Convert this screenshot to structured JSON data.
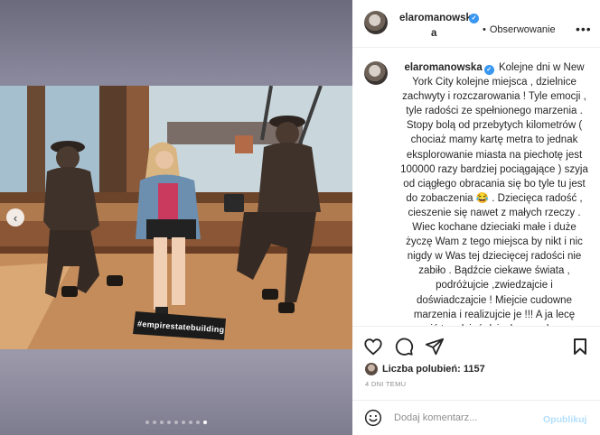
{
  "post": {
    "username_line1": "elaromanowsk",
    "username_line2": "a",
    "follow_separator": "•",
    "follow_label": "Obserwowanie",
    "caption_author": "elaromanowska",
    "caption_text": "Kolejne dni w New York City kolejne miejsca , dzielnice zachwyty i rozczarowania ! Tyle emocji , tyle radości ze spełnionego marzenia . Stopy bolą od przebytych kilometrów ( chociaż mamy kartę metra to jednak eksplorowanie miasta na piechotę jest 100000 razy bardziej pociągające ) szyja od ciągłego obracania się bo tyle tu jest do zobaczenia 😂 . Dziecięca radość , cieszenie się nawet z małych rzeczy . Wiec kochane dzieciaki małe i duże życzę Wam z tego miejsca by nikt i nic nigdy w Was tej dziecięcej radości nie zabiło . Bądźcie ciekawe świata , podróżujcie ,zwiedzajcie i doświadczajcie ! Miejcie cudowne marzenia i realizujcie je !!! A ja lecę uczcić ten dzień dziecka z cudowna , madra i piekielnie zdolna",
    "likes_text": "Liczba polubień: 1157",
    "date_text": "4 DNI TEMU",
    "comment_placeholder": "Dodaj komentarz...",
    "publish_label": "Opublikuj",
    "photo_sign_text": "#empirestatebuilding",
    "carousel": {
      "total": 9,
      "active": 9
    }
  },
  "icons": {
    "media_prev": "chevron-left-icon",
    "more": "more-horizontal-icon",
    "verified": "verified-badge-icon",
    "like": "heart-icon",
    "comment": "comment-bubble-icon",
    "share": "paper-plane-icon",
    "save": "bookmark-icon",
    "emoji": "smiley-icon"
  },
  "colors": {
    "verified": "#3897f0",
    "publish_disabled": "#b2dffc",
    "muted_text": "#8e8e8e",
    "divider": "#efefef"
  }
}
